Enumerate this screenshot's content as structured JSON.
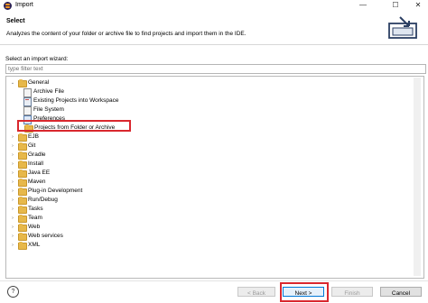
{
  "window": {
    "title": "Import",
    "controls": [
      "minimize-icon",
      "maximize-icon",
      "close-icon"
    ]
  },
  "header": {
    "title": "Select",
    "description": "Analyzes the content of your folder or archive file to find projects and import them in the IDE."
  },
  "wizard": {
    "label": "Select an import wizard:",
    "filter_placeholder": "type filter text",
    "filter_value": ""
  },
  "tree": {
    "items": [
      {
        "label": "General",
        "level": 0,
        "expanded": true,
        "icon": "folder-icon"
      },
      {
        "label": "Archive File",
        "level": 1,
        "icon": "archive-file-icon"
      },
      {
        "label": "Existing Projects into Workspace",
        "level": 1,
        "icon": "project-icon"
      },
      {
        "label": "File System",
        "level": 1,
        "icon": "file-system-icon"
      },
      {
        "label": "Preferences",
        "level": 1,
        "icon": "preferences-icon"
      },
      {
        "label": "Projects from Folder or Archive",
        "level": 1,
        "icon": "folder-icon",
        "selected": true
      },
      {
        "label": "EJB",
        "level": 0,
        "expanded": false,
        "icon": "folder-icon"
      },
      {
        "label": "Git",
        "level": 0,
        "expanded": false,
        "icon": "folder-icon"
      },
      {
        "label": "Gradle",
        "level": 0,
        "expanded": false,
        "icon": "folder-icon"
      },
      {
        "label": "Install",
        "level": 0,
        "expanded": false,
        "icon": "folder-icon"
      },
      {
        "label": "Java EE",
        "level": 0,
        "expanded": false,
        "icon": "folder-icon"
      },
      {
        "label": "Maven",
        "level": 0,
        "expanded": false,
        "icon": "folder-icon"
      },
      {
        "label": "Plug-in Development",
        "level": 0,
        "expanded": false,
        "icon": "folder-icon"
      },
      {
        "label": "Run/Debug",
        "level": 0,
        "expanded": false,
        "icon": "folder-icon"
      },
      {
        "label": "Tasks",
        "level": 0,
        "expanded": false,
        "icon": "folder-icon"
      },
      {
        "label": "Team",
        "level": 0,
        "expanded": false,
        "icon": "folder-icon"
      },
      {
        "label": "Web",
        "level": 0,
        "expanded": false,
        "icon": "folder-icon"
      },
      {
        "label": "Web services",
        "level": 0,
        "expanded": false,
        "icon": "folder-icon"
      },
      {
        "label": "XML",
        "level": 0,
        "expanded": false,
        "icon": "folder-icon"
      }
    ]
  },
  "footer": {
    "help_label": "?",
    "back_label": "< Back",
    "next_label": "Next >",
    "finish_label": "Finish",
    "cancel_label": "Cancel"
  },
  "colors": {
    "highlight": "#d9272e",
    "folder": "#e7b84a",
    "primary_border": "#0078d7"
  }
}
